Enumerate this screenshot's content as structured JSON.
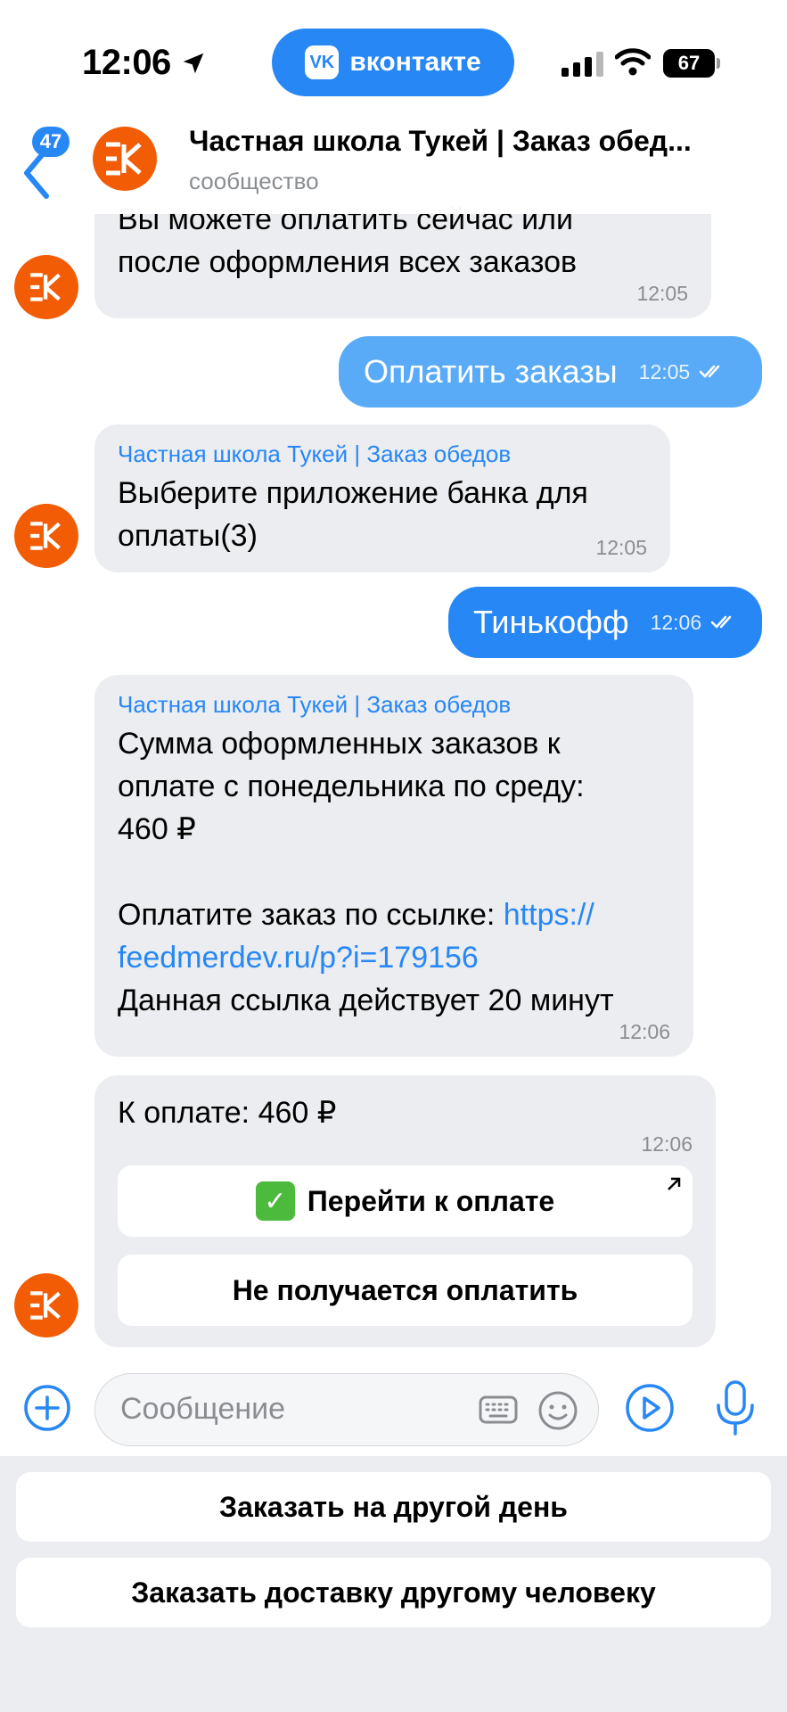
{
  "status_bar": {
    "time": "12:06",
    "app_pill": "вконтакте",
    "vk_logo": "VK",
    "battery": "67"
  },
  "header": {
    "back_badge": "47",
    "title": "Частная школа Тукей | Заказ обед...",
    "subtitle": "сообщество"
  },
  "messages": [
    {
      "type": "in",
      "text_lines": [
        "Вы можете оплатить сейчас или",
        "после оформления всех заказов"
      ],
      "time": "12:05"
    },
    {
      "type": "out",
      "text": "Оплатить заказы",
      "time": "12:05"
    },
    {
      "type": "in",
      "sender": "Частная школа Тукей | Заказ обедов",
      "text_lines": [
        "Выберите приложение банка для",
        "оплаты(3)"
      ],
      "time": "12:05"
    },
    {
      "type": "out",
      "text": "Тинькофф",
      "time": "12:06"
    },
    {
      "type": "in",
      "sender": "Частная школа Тукей | Заказ обедов",
      "text_lines": [
        "Сумма оформленных заказов к",
        "оплате с понедельника по среду:",
        "460 ₽"
      ],
      "link_prefix": "Оплатите заказ по ссылке: ",
      "link_part1": "https://",
      "link_part2": "feedmerdev.ru/p?i=179156",
      "link_note": "Данная ссылка действует 20 минут",
      "time": "12:06"
    },
    {
      "type": "in",
      "text": "К оплате: 460 ₽",
      "time": "12:06",
      "buttons": [
        "Перейти к оплате",
        "Не получается оплатить"
      ]
    }
  ],
  "composer": {
    "placeholder": "Сообщение"
  },
  "keyboard": {
    "buttons": [
      "Заказать на другой день",
      "Заказать доставку другому человеку"
    ]
  },
  "colors": {
    "accent": "#2787f5",
    "avatar": "#f25c05",
    "bubble_in": "#ebedf0"
  },
  "icons": [
    "location-arrow-icon",
    "signal-icon",
    "wifi-icon",
    "back-chevron-icon",
    "double-check-icon",
    "check-mark-icon",
    "external-link-icon",
    "plus-icon",
    "keyboard-icon",
    "emoji-icon",
    "play-icon",
    "microphone-icon"
  ]
}
